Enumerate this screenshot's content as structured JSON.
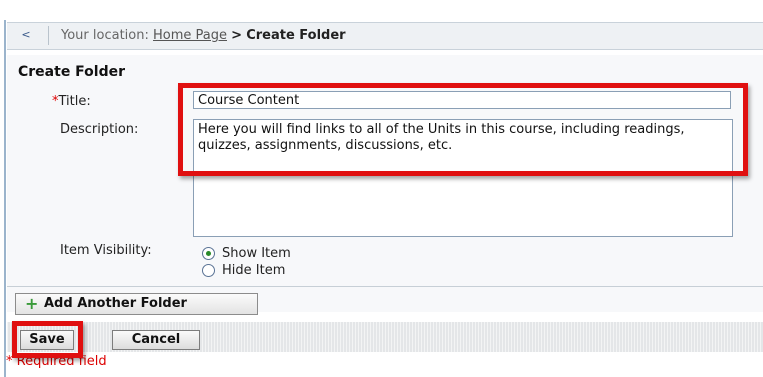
{
  "breadcrumb": {
    "back_glyph": "<",
    "prefix": "Your location:",
    "home_link": "Home Page",
    "separator": ">",
    "current": "Create Folder"
  },
  "form": {
    "heading": "Create Folder",
    "required_mark": "*",
    "title_label": "Title:",
    "title_value": "Course Content",
    "description_label": "Description:",
    "description_value": "Here you will find links to all of the Units in this course, including readings, quizzes, assignments, discussions, etc.",
    "visibility_label": "Item Visibility:",
    "visibility_options": [
      {
        "label": "Show Item",
        "selected": true
      },
      {
        "label": "Hide Item",
        "selected": false
      }
    ],
    "add_button_icon": "add-plus-icon",
    "add_button_label": "Add Another Folder"
  },
  "actions": {
    "save_label": "Save",
    "cancel_label": "Cancel"
  },
  "required_note": "* Required field",
  "colors": {
    "highlight": "#e01010",
    "required": "#dd0000",
    "radio_selected": "#2a8a2a"
  }
}
